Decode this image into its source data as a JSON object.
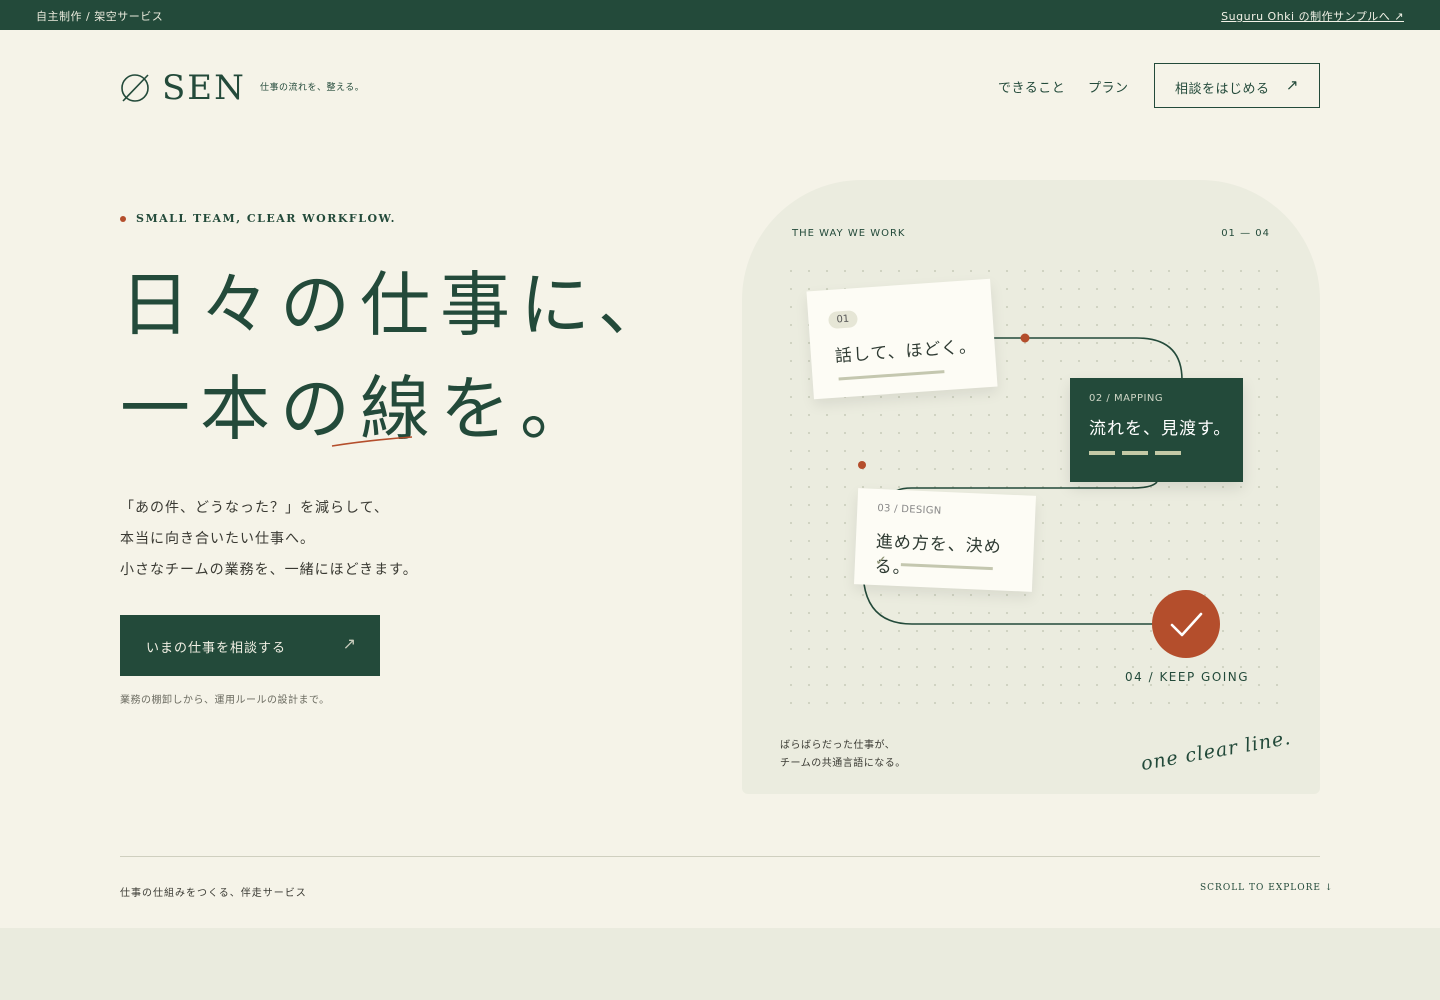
{
  "topbar": {
    "left": "自主制作 / 架空サービス",
    "right": "Suguru Ohki の制作サンプルへ ↗"
  },
  "brand": {
    "name": "SEN",
    "tagline": "仕事の流れを、整える。"
  },
  "nav": {
    "item1": "できること",
    "item2": "プラン",
    "button": "相談をはじめる",
    "button_arrow": "↗"
  },
  "hero": {
    "eyebrow": "SMALL TEAM, CLEAR WORKFLOW.",
    "title_line1": "日々の仕事に、",
    "title_line2_a": "一本の",
    "title_line2_b": "線",
    "title_line2_c": "を。",
    "body1": "「あの件、どうなった？」を減らして、",
    "body2": "本当に向き合いたい仕事へ。",
    "body3": "小さなチームの業務を、一緒にほどきます。",
    "cta": "いまの仕事を相談する",
    "cta_arrow": "↗",
    "cta_note": "業務の棚卸しから、運用ルールの設計まで。"
  },
  "panel": {
    "header_left": "THE WAY WE WORK",
    "header_right": "01 — 04",
    "card1_num": "01",
    "card1_text": "話して、ほどく。",
    "card2_label": "02 / MAPPING",
    "card2_text": "流れを、見渡す。",
    "card3_label": "03 / DESIGN",
    "card3_text": "進め方を、決める。",
    "card3_check": "✓",
    "step4_label": "04 / KEEP GOING",
    "foot1": "ばらばらだった仕事が、",
    "foot2": "チームの共通言語になる。",
    "script": "one clear line."
  },
  "footer": {
    "left": "仕事の仕組みをつくる、伴走サービス",
    "right": "SCROLL TO EXPLORE ↓"
  },
  "colors": {
    "primary": "#234a3a",
    "accent": "#b44e2c",
    "background": "#f5f3e8",
    "panel": "#ebecdf"
  }
}
